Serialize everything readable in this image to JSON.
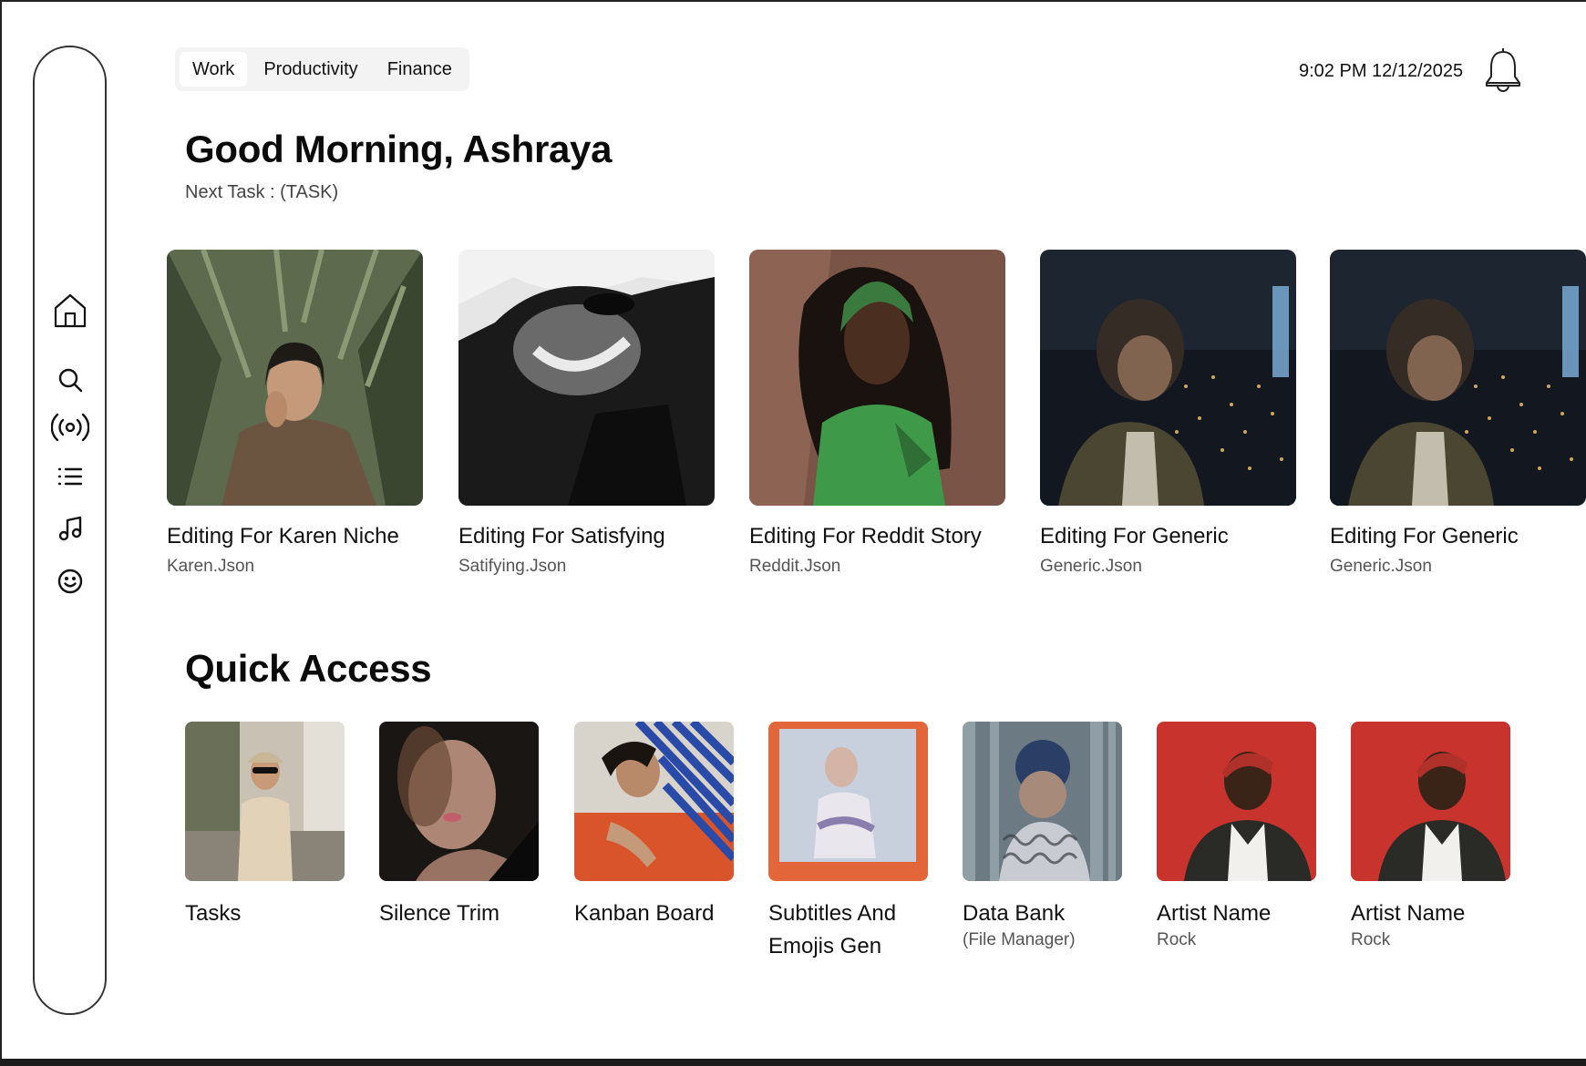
{
  "tabs": [
    {
      "label": "Work",
      "active": true
    },
    {
      "label": "Productivity",
      "active": false
    },
    {
      "label": "Finance",
      "active": false
    }
  ],
  "header": {
    "datetime": "9:02 PM 12/12/2025"
  },
  "greeting": {
    "title": "Good Morning, Ashraya",
    "next_task": "Next Task : (TASK)"
  },
  "sidebar": {
    "icons": [
      "home-icon",
      "search-icon",
      "broadcast-icon",
      "list-icon",
      "music-note-icon",
      "smiley-icon"
    ]
  },
  "recent": [
    {
      "title": "Editing For Karen Niche",
      "file": "Karen.Json",
      "image": "woman-in-palm-leaves"
    },
    {
      "title": "Editing For Satisfying",
      "file": "Satifying.Json",
      "image": "black-and-white-sunglasses-portrait"
    },
    {
      "title": "Editing For Reddit Story",
      "file": "Reddit.Json",
      "image": "woman-in-green-with-net-headpiece"
    },
    {
      "title": "Editing For Generic",
      "file": "Generic.Json",
      "image": "blurred-man-city-night"
    },
    {
      "title": "Editing For Generic",
      "file": "Generic.Json",
      "image": "blurred-man-city-night"
    }
  ],
  "quick_access": {
    "title": "Quick Access",
    "items": [
      {
        "title": "Tasks",
        "sub": "",
        "image": "woman-in-cap-street"
      },
      {
        "title": "Silence Trim",
        "sub": "",
        "image": "blurred-woman-portrait"
      },
      {
        "title": "Kanban Board",
        "sub": "",
        "image": "woman-lying-striped-shirt"
      },
      {
        "title": "Subtitles And Emojis Gen",
        "sub": "",
        "image": "polaroid-man-orange-frame"
      },
      {
        "title": "Data Bank",
        "sub": "(File Manager)",
        "image": "distorted-glass-portrait"
      },
      {
        "title": "Artist Name",
        "sub": "Rock",
        "image": "man-red-beanie-red-background"
      },
      {
        "title": "Artist Name",
        "sub": "Rock",
        "image": "man-red-beanie-red-background"
      }
    ]
  },
  "colors": {
    "tab_bg": "#f3f3f3",
    "sidebar_border": "#333333",
    "text_primary": "#111111",
    "text_secondary": "#555555"
  }
}
